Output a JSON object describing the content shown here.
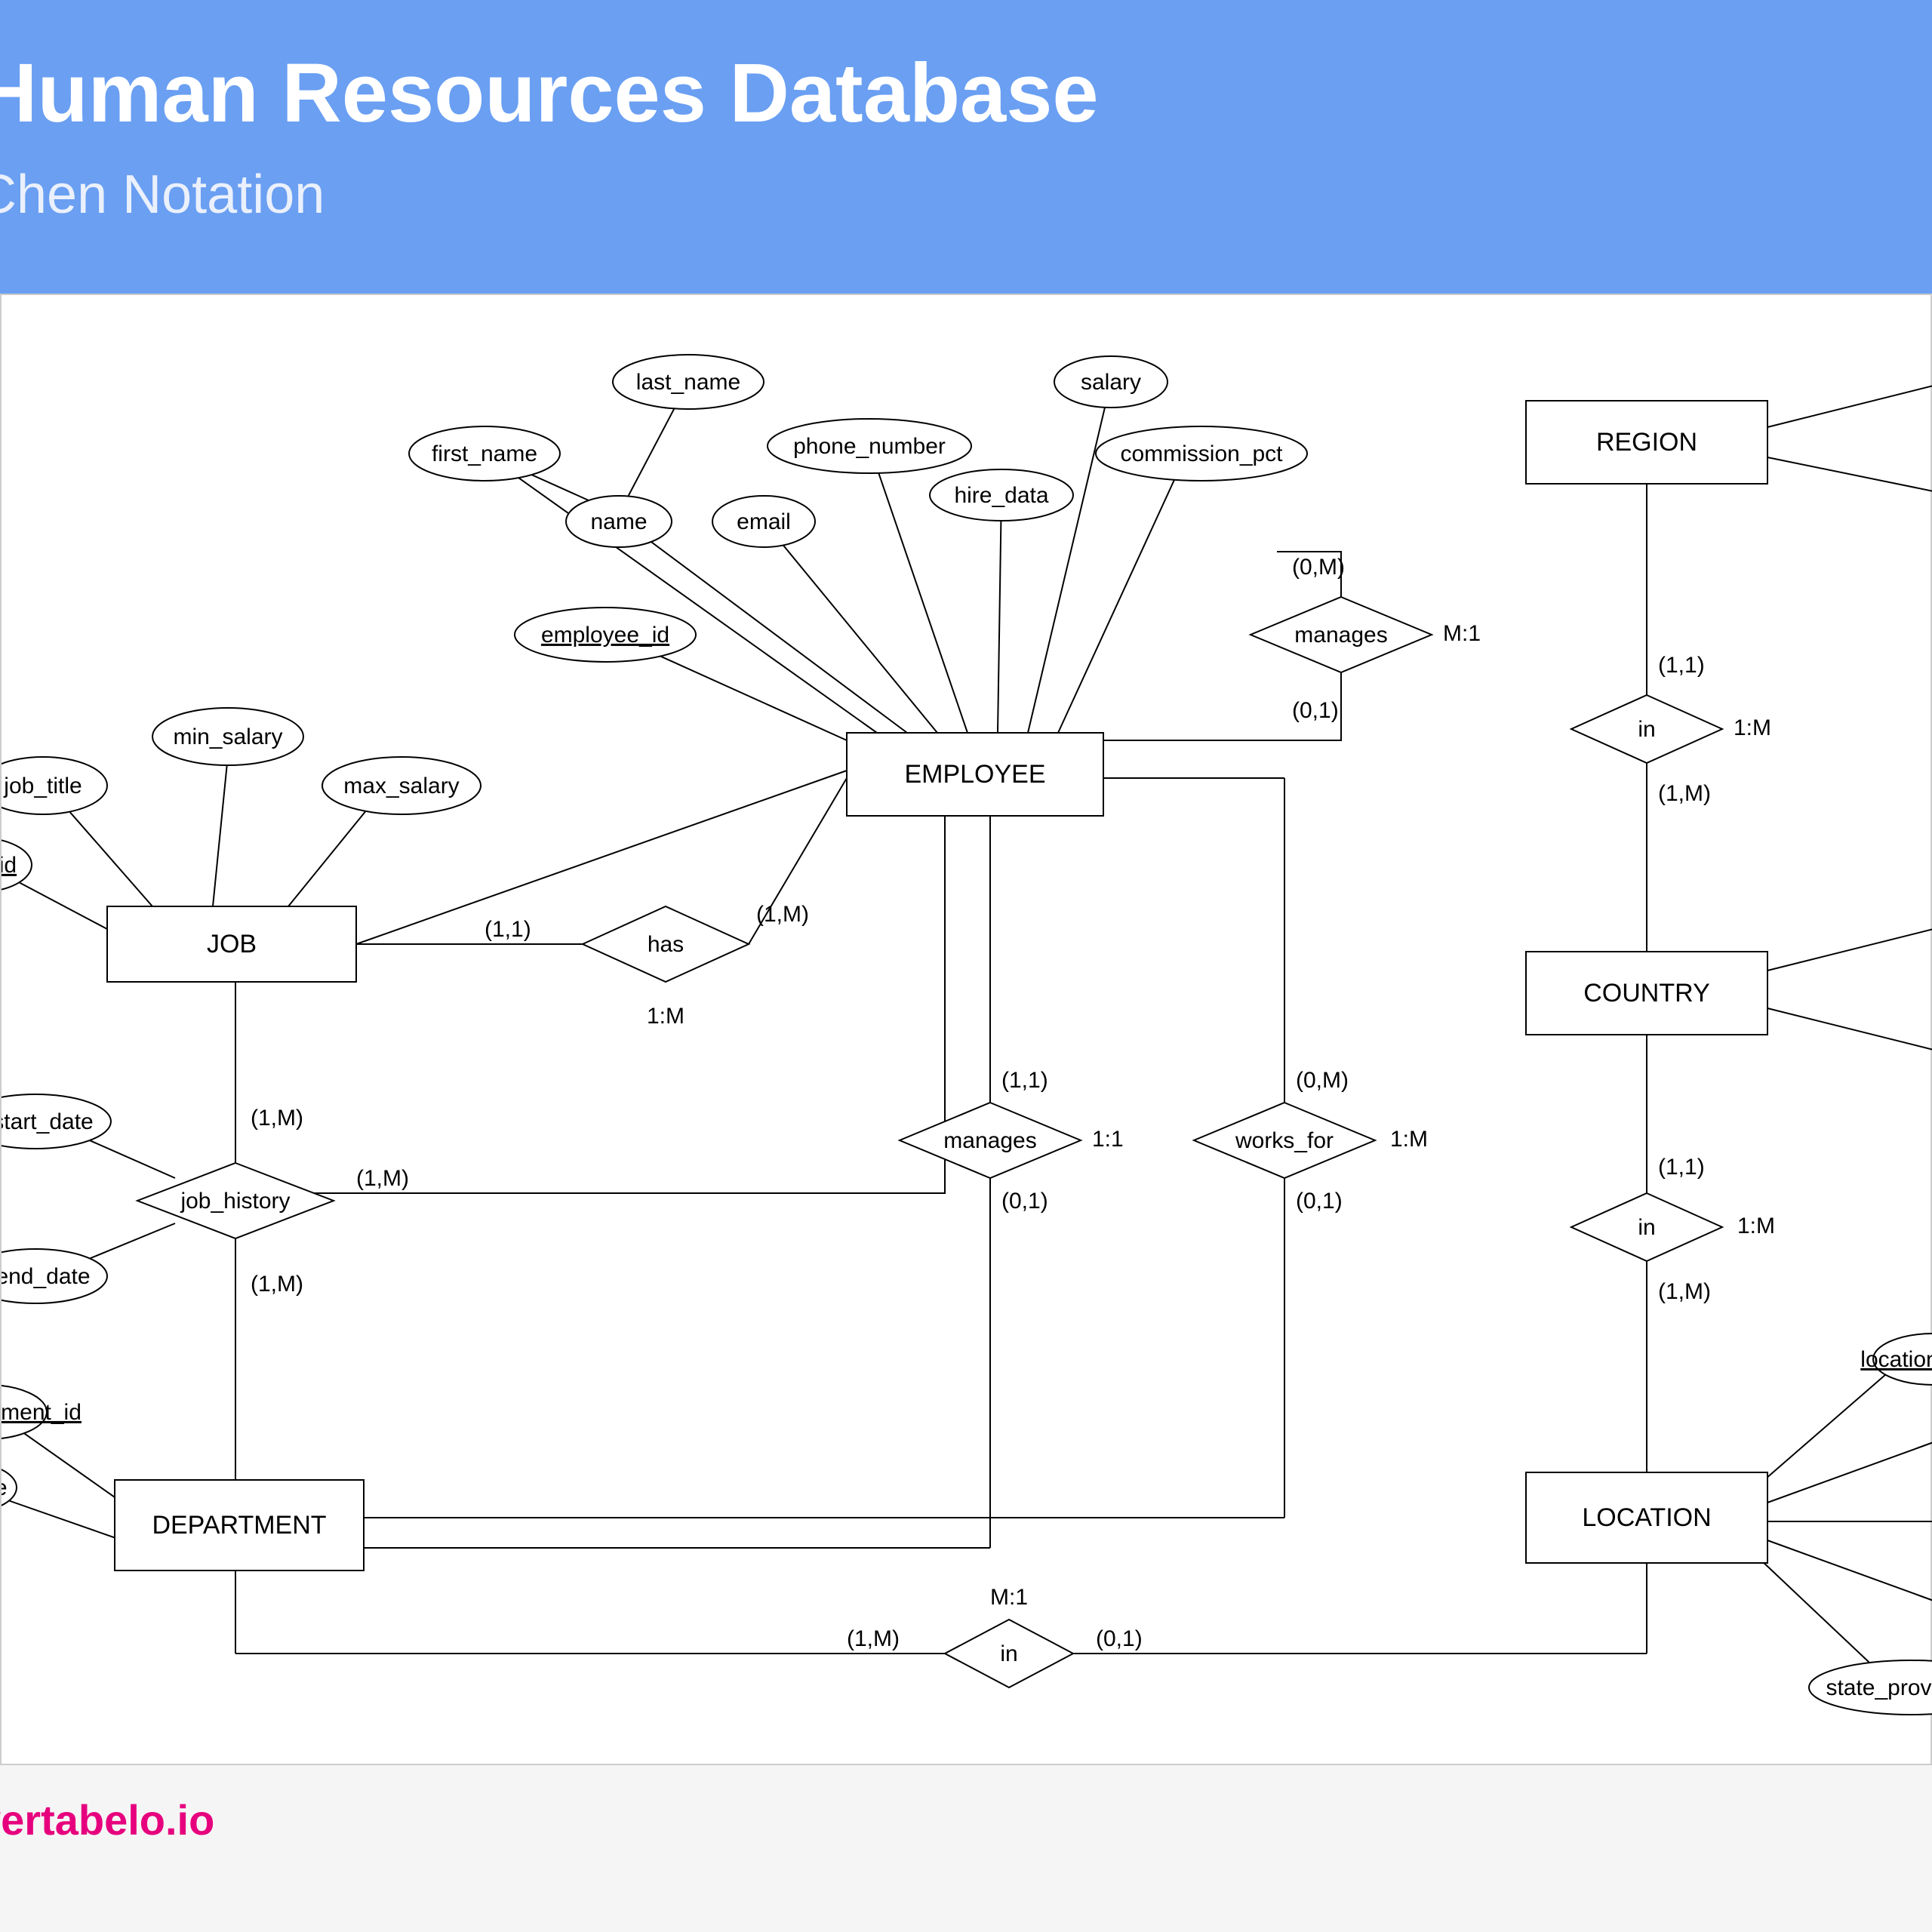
{
  "header": {
    "title": "Human Resources Database",
    "subtitle": "Chen Notation"
  },
  "footer": {
    "brand": "vertabelo.io"
  },
  "entities": {
    "job": "JOB",
    "employee": "EMPLOYEE",
    "department": "DEPARTMENT",
    "region": "REGION",
    "country": "COUNTRY",
    "location": "LOCATION"
  },
  "attributes": {
    "min_salary": "min_salary",
    "job_title": "job_title",
    "max_salary": "max_salary",
    "job_id": "job_id",
    "first_name": "first_name",
    "last_name": "last_name",
    "name": "name",
    "email": "email",
    "phone_number": "phone_number",
    "hire_data": "hire_data",
    "salary": "salary",
    "commission_pct": "commission_pct",
    "employee_id": "employee_id",
    "start_date": "start_date",
    "end_date": "end_date",
    "dept_id": "department_id",
    "dept_name": "name",
    "loc_id": "location_id",
    "state_province": "state_province"
  },
  "relationships": {
    "has": "has",
    "job_history": "job_history",
    "manages_self": "manages",
    "manages_dept": "manages",
    "works_for": "works_for",
    "in_region_country": "in",
    "in_country_location": "in",
    "in_dept_location": "in"
  },
  "cardinalities": {
    "has_job": "(1,1)",
    "has_emp": "(1,M)",
    "has_ratio": "1:M",
    "manages_self_top": "(0,M)",
    "manages_self_bot": "(0,1)",
    "manages_self_ratio": "M:1",
    "manages_dept_top": "(1,1)",
    "manages_dept_bot": "(0,1)",
    "manages_dept_ratio": "1:1",
    "works_for_top": "(0,M)",
    "works_for_bot": "(0,1)",
    "works_for_ratio": "1:M",
    "jobhist_job": "(1,M)",
    "jobhist_emp": "(1,M)",
    "jobhist_dept": "(1,M)",
    "in_rc_top": "(1,1)",
    "in_rc_bot": "(1,M)",
    "in_rc_ratio": "1:M",
    "in_cl_top": "(1,1)",
    "in_cl_bot": "(1,M)",
    "in_cl_ratio": "1:M",
    "in_dl_left": "(1,M)",
    "in_dl_right": "(0,1)",
    "in_dl_ratio": "M:1"
  }
}
